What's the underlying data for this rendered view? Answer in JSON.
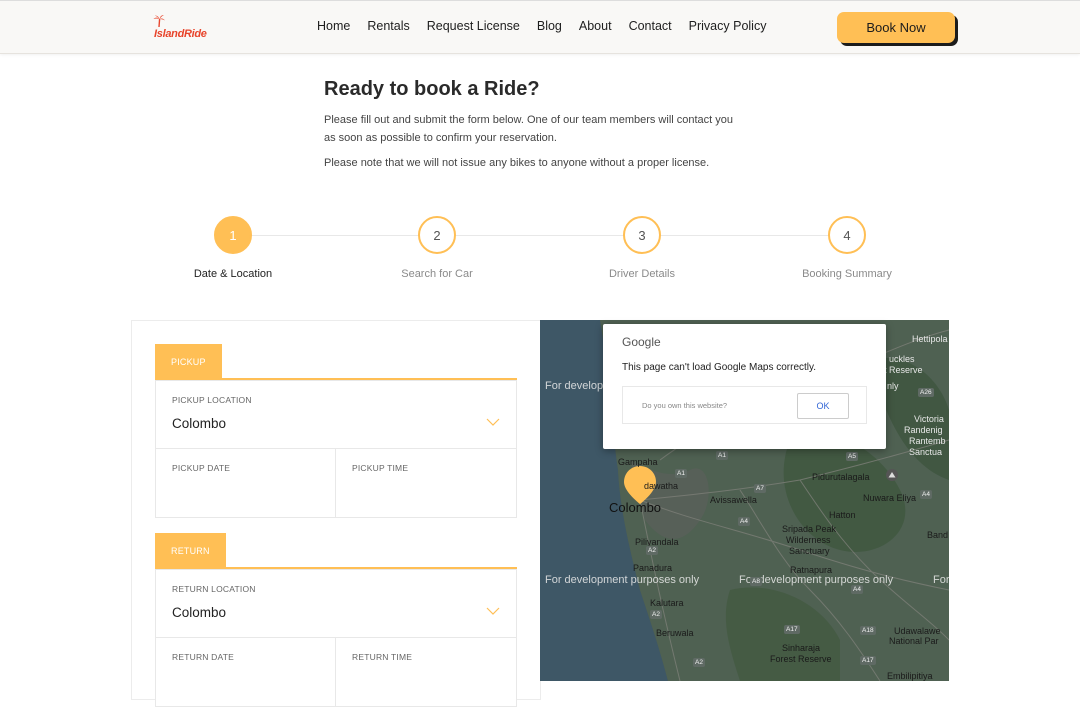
{
  "header": {
    "logo_text": "IslandRide",
    "nav": [
      "Home",
      "Rentals",
      "Request License",
      "Blog",
      "About",
      "Contact",
      "Privacy Policy"
    ],
    "book_now": "Book Now",
    "accent_color": "#ffbf55"
  },
  "intro": {
    "title": "Ready to book a Ride?",
    "paragraph": "Please fill out and submit the form below. One of our team members will contact you as soon as possible to confirm your reservation.",
    "note": "Please note that we will not issue any bikes to anyone without a proper license."
  },
  "steps": [
    {
      "number": "1",
      "label": "Date & Location",
      "active": true
    },
    {
      "number": "2",
      "label": "Search for Car",
      "active": false
    },
    {
      "number": "3",
      "label": "Driver Details",
      "active": false
    },
    {
      "number": "4",
      "label": "Booking Summary",
      "active": false
    }
  ],
  "pickup": {
    "tab": "PICKUP",
    "location_label": "PICKUP LOCATION",
    "location_value": "Colombo",
    "date_label": "PICKUP DATE",
    "time_label": "PICKUP TIME"
  },
  "return": {
    "tab": "RETURN",
    "location_label": "RETURN LOCATION",
    "location_value": "Colombo",
    "date_label": "RETURN DATE",
    "time_label": "RETURN TIME"
  },
  "map": {
    "dev_text": "For development purposes only",
    "pin_label": "Colombo",
    "labels": {
      "hettipola": "Hettipola",
      "knuckles": "uckles",
      "reserve": "t Reserve",
      "only": "nly",
      "victoria": "Victoria",
      "randenigala": "Randenig",
      "rantembe": "Rantemb",
      "sanctuary": "Sanctua",
      "gampaha": "Gampaha",
      "negombo": "dawatha",
      "avissawella": "Avissawella",
      "pidurutalagala": "Pidurutalagala",
      "nuwara_eliya": "Nuwara Eliya",
      "hatton": "Hatton",
      "sripada": "Sripada Peak",
      "peak_wild": "Wilderness",
      "peak_sanct": "Sanctuary",
      "band": "Band",
      "piliyandala": "Piliyandala",
      "panadura": "Panadura",
      "ratnapura": "Ratnapura",
      "kalutara": "Kalutara",
      "beruwala": "Beruwala",
      "udawalawe": "Udawalawe",
      "national_park": "National Par",
      "sinharaja": "Sinharaja",
      "forest_reserve": "Forest Reserve",
      "embilipitiya": "Embilipitiya"
    },
    "road_badges": [
      "A26",
      "A1",
      "A1",
      "A4",
      "A7",
      "A5",
      "A4",
      "A8",
      "A4",
      "A2",
      "A2",
      "A18",
      "A17",
      "A17",
      "A2"
    ]
  },
  "google_dialog": {
    "brand": "Google",
    "message": "This page can't load Google Maps correctly.",
    "question": "Do you own this website?",
    "ok": "OK"
  }
}
